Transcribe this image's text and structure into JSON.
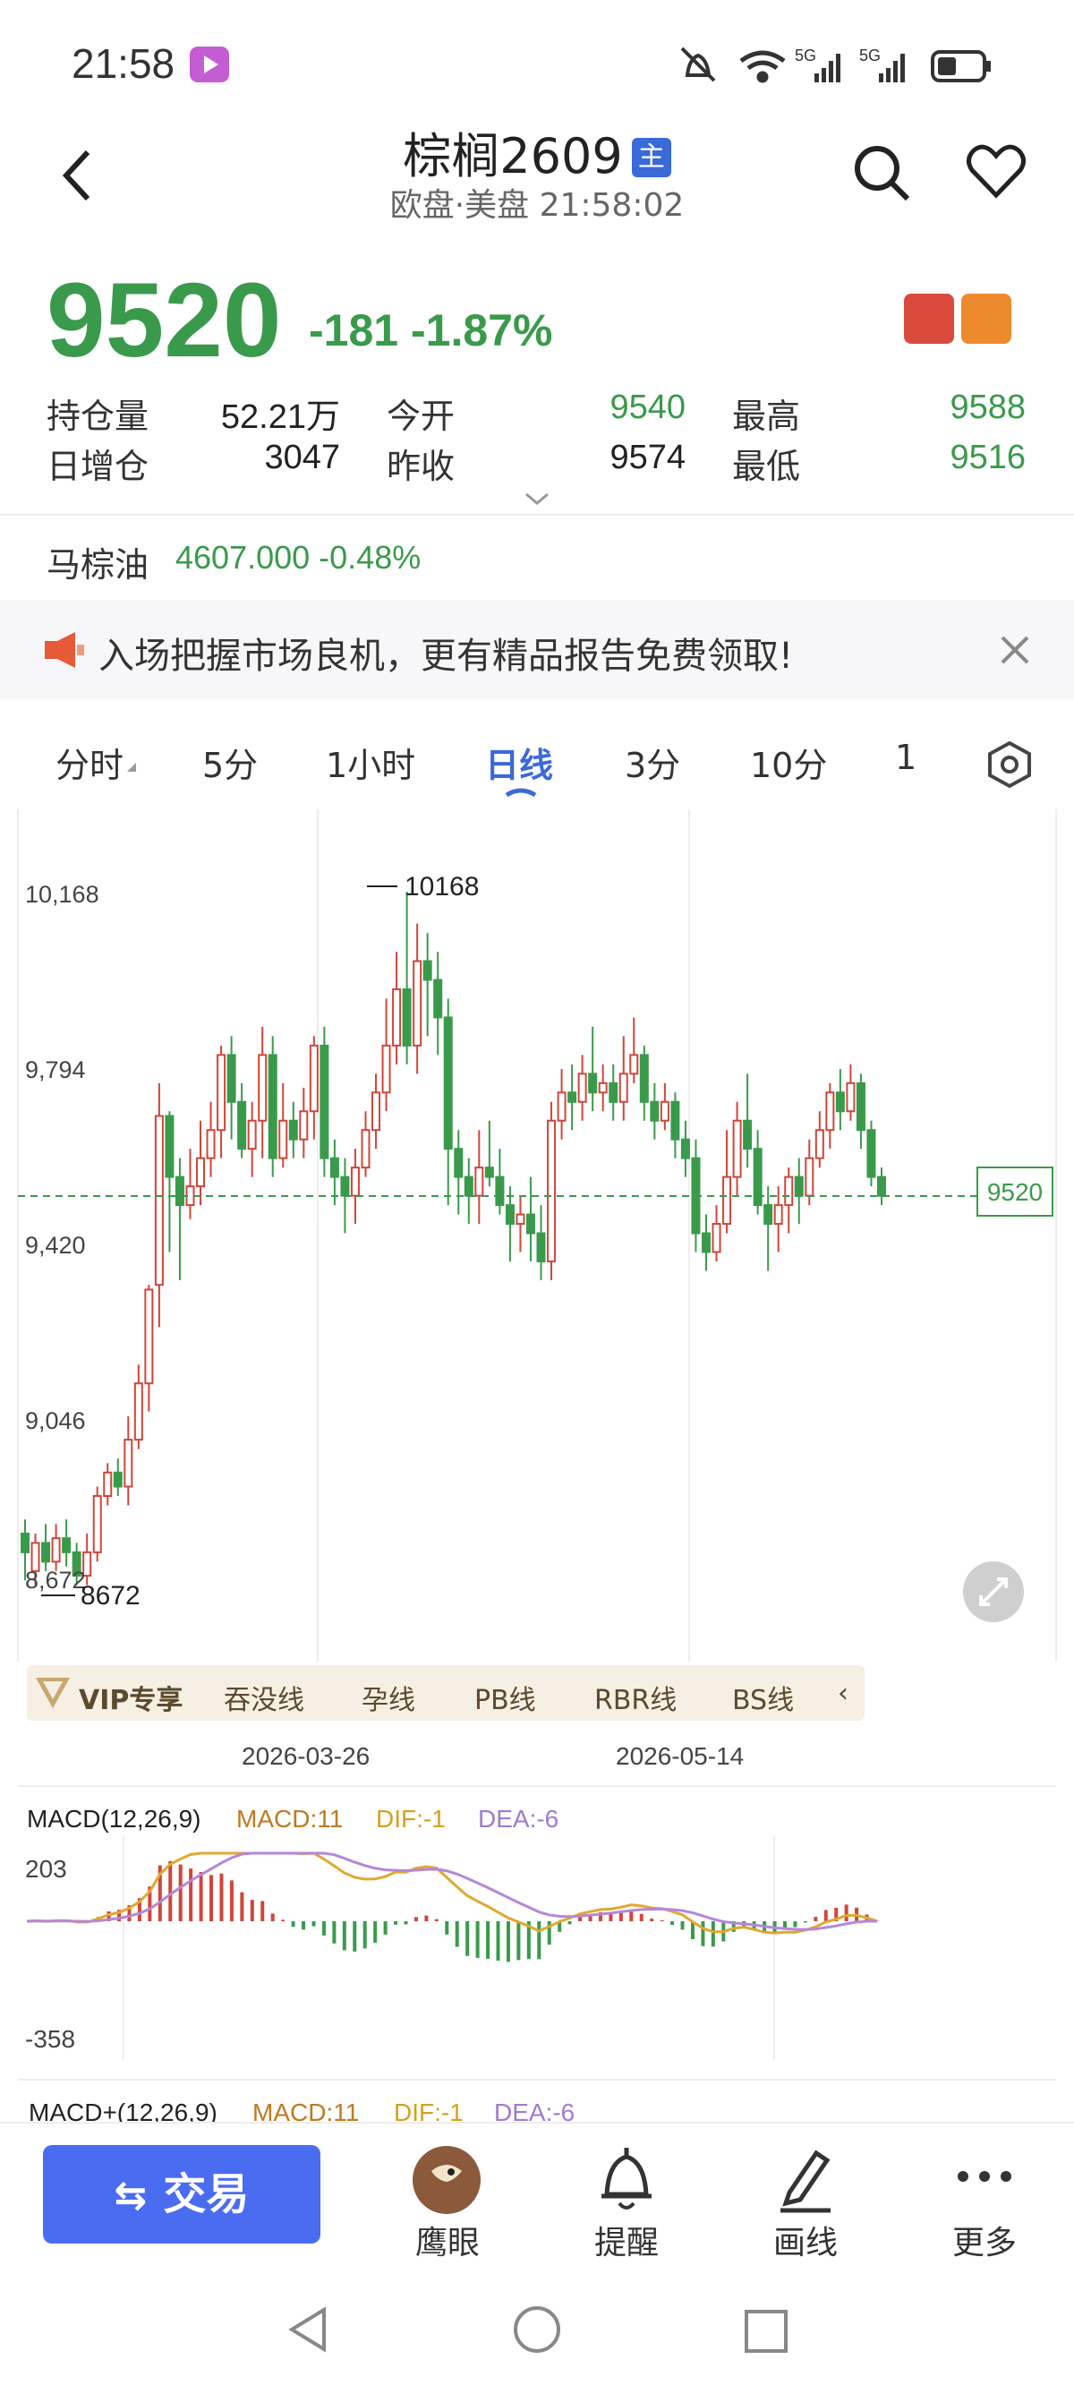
{
  "status_bar": {
    "time": "21:58",
    "network": "5G",
    "network2": "5G"
  },
  "header": {
    "title": "棕榈2609",
    "badge": "主",
    "subtitle": "欧盘·美盘 21:58:02"
  },
  "quote": {
    "price": "9520",
    "change": "-181",
    "change_pct": "-1.87%",
    "stats": [
      {
        "label": "持仓量",
        "value": "52.21万"
      },
      {
        "label": "今开",
        "value": "9540"
      },
      {
        "label": "最高",
        "value": "9588"
      },
      {
        "label": "日增仓",
        "value": "3047"
      },
      {
        "label": "昨收",
        "value": "9574"
      },
      {
        "label": "最低",
        "value": "9516"
      }
    ],
    "related_name": "马棕油",
    "related_value": "4607.000 -0.48%"
  },
  "banner": {
    "text": "入场把握市场良机，更有精品报告免费领取!"
  },
  "tabs": [
    {
      "label": "分时",
      "active": false
    },
    {
      "label": "5分",
      "active": false
    },
    {
      "label": "1小时",
      "active": false
    },
    {
      "label": "日线",
      "active": true
    },
    {
      "label": "3分",
      "active": false
    },
    {
      "label": "10分",
      "active": false
    },
    {
      "label": "1",
      "active": false
    }
  ],
  "chart_data": {
    "type": "candlestick",
    "y_ticks": [
      "10,168",
      "9,794",
      "9,420",
      "9,046",
      "8,672"
    ],
    "x_ticks": [
      "2026-03-26",
      "2026-05-14"
    ],
    "high_marker": "10168",
    "low_marker": "8672",
    "last_price_tag": "9520",
    "candles": [
      [
        8800,
        8760,
        8830,
        8700
      ],
      [
        8720,
        8780,
        8800,
        8690
      ],
      [
        8780,
        8740,
        8820,
        8720
      ],
      [
        8740,
        8790,
        8820,
        8720
      ],
      [
        8790,
        8760,
        8830,
        8730
      ],
      [
        8760,
        8710,
        8780,
        8690
      ],
      [
        8710,
        8760,
        8800,
        8690
      ],
      [
        8760,
        8880,
        8900,
        8740
      ],
      [
        8880,
        8930,
        8950,
        8860
      ],
      [
        8930,
        8900,
        8960,
        8880
      ],
      [
        8900,
        9000,
        9050,
        8860
      ],
      [
        9000,
        9120,
        9160,
        8980
      ],
      [
        9120,
        9320,
        9330,
        9060
      ],
      [
        9330,
        9690,
        9760,
        9240
      ],
      [
        9690,
        9560,
        9700,
        9400
      ],
      [
        9560,
        9500,
        9600,
        9340
      ],
      [
        9500,
        9540,
        9620,
        9470
      ],
      [
        9540,
        9600,
        9680,
        9500
      ],
      [
        9600,
        9660,
        9720,
        9560
      ],
      [
        9660,
        9820,
        9840,
        9600
      ],
      [
        9820,
        9720,
        9860,
        9640
      ],
      [
        9720,
        9620,
        9760,
        9600
      ],
      [
        9620,
        9680,
        9720,
        9560
      ],
      [
        9680,
        9820,
        9880,
        9600
      ],
      [
        9820,
        9600,
        9860,
        9560
      ],
      [
        9600,
        9680,
        9760,
        9580
      ],
      [
        9680,
        9640,
        9720,
        9600
      ],
      [
        9640,
        9700,
        9750,
        9600
      ],
      [
        9700,
        9840,
        9860,
        9640
      ],
      [
        9840,
        9600,
        9880,
        9560
      ],
      [
        9600,
        9560,
        9640,
        9500
      ],
      [
        9560,
        9520,
        9600,
        9440
      ],
      [
        9520,
        9580,
        9620,
        9460
      ],
      [
        9580,
        9660,
        9700,
        9560
      ],
      [
        9660,
        9740,
        9780,
        9620
      ],
      [
        9740,
        9840,
        9940,
        9700
      ],
      [
        9840,
        9960,
        10040,
        9800
      ],
      [
        9960,
        9840,
        10168,
        9800
      ],
      [
        9840,
        10020,
        10100,
        9780
      ],
      [
        10020,
        9980,
        10080,
        9860
      ],
      [
        9980,
        9900,
        10040,
        9820
      ],
      [
        9900,
        9620,
        9940,
        9500
      ],
      [
        9620,
        9560,
        9660,
        9480
      ],
      [
        9560,
        9520,
        9600,
        9460
      ],
      [
        9520,
        9580,
        9660,
        9460
      ],
      [
        9580,
        9560,
        9680,
        9540
      ],
      [
        9560,
        9500,
        9620,
        9480
      ],
      [
        9500,
        9460,
        9540,
        9380
      ],
      [
        9460,
        9480,
        9520,
        9400
      ],
      [
        9480,
        9440,
        9560,
        9380
      ],
      [
        9440,
        9380,
        9500,
        9340
      ],
      [
        9380,
        9680,
        9720,
        9340
      ],
      [
        9680,
        9740,
        9790,
        9640
      ],
      [
        9740,
        9720,
        9800,
        9660
      ],
      [
        9720,
        9780,
        9820,
        9680
      ],
      [
        9780,
        9740,
        9880,
        9700
      ],
      [
        9740,
        9760,
        9800,
        9700
      ],
      [
        9760,
        9720,
        9800,
        9680
      ],
      [
        9720,
        9780,
        9860,
        9680
      ],
      [
        9780,
        9820,
        9900,
        9760
      ],
      [
        9820,
        9720,
        9840,
        9680
      ],
      [
        9720,
        9680,
        9760,
        9640
      ],
      [
        9680,
        9720,
        9760,
        9660
      ],
      [
        9720,
        9640,
        9740,
        9600
      ],
      [
        9640,
        9600,
        9680,
        9560
      ],
      [
        9600,
        9440,
        9640,
        9400
      ],
      [
        9440,
        9400,
        9480,
        9360
      ],
      [
        9400,
        9460,
        9500,
        9380
      ],
      [
        9460,
        9560,
        9660,
        9440
      ],
      [
        9560,
        9680,
        9720,
        9520
      ],
      [
        9680,
        9620,
        9780,
        9580
      ],
      [
        9620,
        9500,
        9660,
        9480
      ],
      [
        9500,
        9460,
        9540,
        9360
      ],
      [
        9460,
        9500,
        9540,
        9400
      ],
      [
        9500,
        9560,
        9580,
        9440
      ],
      [
        9560,
        9520,
        9600,
        9460
      ],
      [
        9520,
        9600,
        9640,
        9500
      ],
      [
        9600,
        9660,
        9700,
        9580
      ],
      [
        9660,
        9740,
        9760,
        9620
      ],
      [
        9740,
        9700,
        9790,
        9660
      ],
      [
        9700,
        9760,
        9800,
        9680
      ],
      [
        9760,
        9660,
        9780,
        9620
      ],
      [
        9660,
        9560,
        9680,
        9540
      ],
      [
        9560,
        9520,
        9580,
        9500
      ]
    ]
  },
  "vip_bar": {
    "title": "VIP专享",
    "items": [
      "吞没线",
      "孕线",
      "PB线",
      "RBR线",
      "BS线"
    ]
  },
  "macd": {
    "title": "MACD(12,26,9)",
    "macd": "MACD:11",
    "dif": "DIF:-1",
    "dea": "DEA:-6",
    "y_top": "203",
    "y_bottom": "-358",
    "title2": "MACD+(12,26,9)",
    "macd2": "MACD:11",
    "dif2": "DIF:-1",
    "dea2": "DEA:-6"
  },
  "bottom_bar": {
    "trade": "交易",
    "items": [
      "鹰眼",
      "提醒",
      "画线",
      "更多"
    ]
  }
}
